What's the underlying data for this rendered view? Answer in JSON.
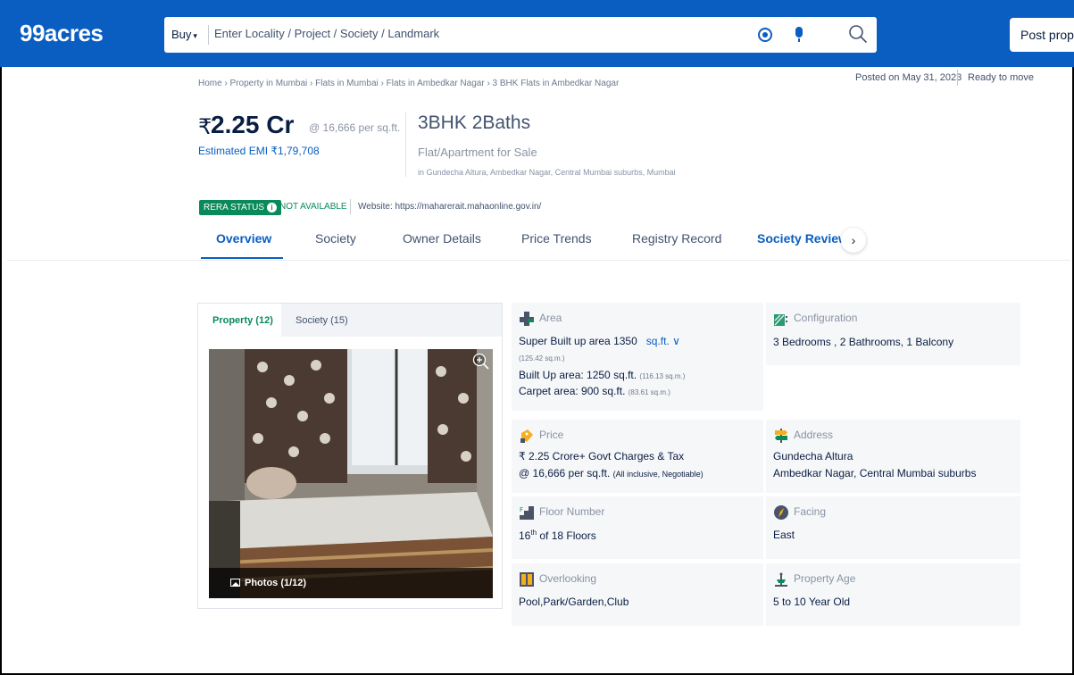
{
  "header": {
    "logo": "99acres",
    "buy_label": "Buy",
    "search_placeholder": "Enter Locality / Project / Society / Landmark",
    "post_button": "Post proper"
  },
  "breadcrumb": "Home › Property in Mumbai › Flats in Mumbai › Flats in Ambedkar Nagar › 3 BHK Flats in Ambedkar Nagar",
  "meta": {
    "posted": "Posted on May 31, 2023",
    "status": "Ready to move"
  },
  "price": {
    "currency": "₹",
    "amount": "2.25 Cr",
    "per_sqft": "@ 16,666 per sq.ft.",
    "emi": "Estimated EMI ₹1,79,708"
  },
  "config": {
    "title": "3BHK 2Baths",
    "subtitle": "Flat/Apartment for Sale",
    "location": "in Gundecha Altura, Ambedkar Nagar, Central Mumbai suburbs, Mumbai"
  },
  "rera": {
    "badge": "RERA STATUS",
    "status": "NOT AVAILABLE",
    "website": "Website: https://maharerait.mahaonline.gov.in/"
  },
  "tabs": [
    "Overview",
    "Society",
    "Owner Details",
    "Price Trends",
    "Registry Record",
    "Society Reviews"
  ],
  "media": {
    "tab_property": "Property (12)",
    "tab_society": "Society (15)",
    "photo_caption": "Photos (1/12)"
  },
  "details": {
    "area": {
      "label": "Area",
      "super_built_prefix": "Super Built up area 1350",
      "unit": "sq.ft.",
      "super_built_sqm": "(125.42 sq.m.)",
      "built_up": "Built Up area: 1250 sq.ft.",
      "built_up_sqm": "(116.13 sq.m.)",
      "carpet": "Carpet area: 900 sq.ft.",
      "carpet_sqm": "(83.61 sq.m.)"
    },
    "configuration": {
      "label": "Configuration",
      "value": "3 Bedrooms , 2 Bathrooms, 1 Balcony"
    },
    "price": {
      "label": "Price",
      "line1": "₹ 2.25 Crore+ Govt Charges & Tax",
      "line2": "@ 16,666 per sq.ft.",
      "line2_note": "(All inclusive, Negotiable)"
    },
    "address": {
      "label": "Address",
      "line1": "Gundecha Altura",
      "line2": "Ambedkar Nagar, Central Mumbai suburbs"
    },
    "floor": {
      "label": "Floor Number",
      "floor": "16",
      "suffix": "th",
      "rest": " of 18 Floors"
    },
    "facing": {
      "label": "Facing",
      "value": "East"
    },
    "overlooking": {
      "label": "Overlooking",
      "value": "Pool,Park/Garden,Club"
    },
    "age": {
      "label": "Property Age",
      "value": "5 to 10 Year Old"
    }
  },
  "colors": {
    "brand_blue": "#0a5ec1",
    "rera_green": "#0a8a5b"
  }
}
